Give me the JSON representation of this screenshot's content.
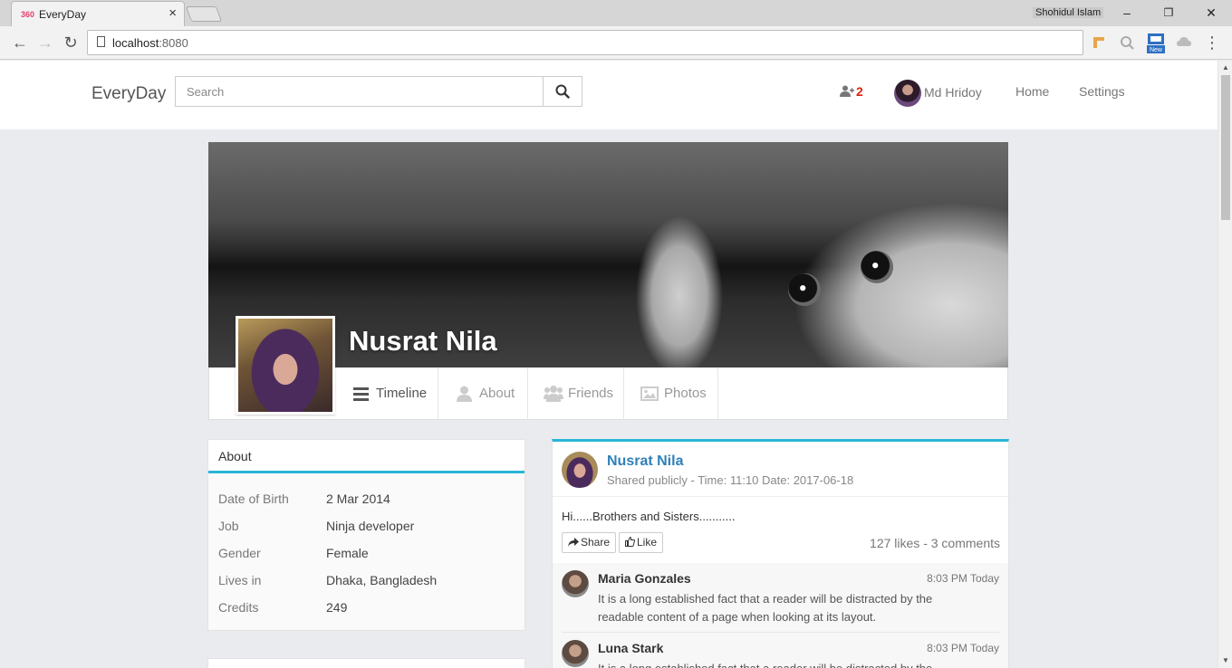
{
  "browser": {
    "tab_title": "EveryDay",
    "tab_favicon": "360",
    "tab_close": "×",
    "profile_name": "Shohidul Islam",
    "window": {
      "minimize": "–",
      "restore": "❐",
      "close": "✕"
    },
    "nav": {
      "back": "←",
      "forward": "→",
      "reload": "↻",
      "menu": "⋮"
    },
    "url_host": "localhost",
    "url_port": ":8080",
    "extension_badge": "New"
  },
  "site": {
    "brand": "EveryDay",
    "search_placeholder": "Search",
    "friend_requests_count": "2",
    "user_name": "Md Hridoy",
    "nav_links": [
      "Home",
      "Settings"
    ]
  },
  "profile": {
    "name": "Nusrat Nila",
    "tabs": [
      {
        "label": "Timeline",
        "icon": "bars-icon",
        "active": true
      },
      {
        "label": "About",
        "icon": "user-icon",
        "active": false
      },
      {
        "label": "Friends",
        "icon": "users-icon",
        "active": false
      },
      {
        "label": "Photos",
        "icon": "image-icon",
        "active": false
      }
    ]
  },
  "about": {
    "heading": "About",
    "rows": [
      {
        "key": "Date of Birth",
        "value": "2 Mar 2014"
      },
      {
        "key": "Job",
        "value": "Ninja developer"
      },
      {
        "key": "Gender",
        "value": "Female"
      },
      {
        "key": "Lives in",
        "value": "Dhaka, Bangladesh"
      },
      {
        "key": "Credits",
        "value": "249"
      }
    ]
  },
  "post": {
    "author": "Nusrat Nila",
    "meta": "Shared publicly -  Time:  11:10   Date:  2017-06-18",
    "text": "Hi......Brothers and Sisters...........",
    "share_label": "Share",
    "like_label": "Like",
    "stats": "127 likes - 3 comments",
    "comments": [
      {
        "name": "Maria Gonzales",
        "time": "8:03 PM Today",
        "text": "It is a long established fact that a reader will be distracted by the readable content of a page when looking at its layout."
      },
      {
        "name": "Luna Stark",
        "time": "8:03 PM Today",
        "text": "It is a long established fact that a reader will be distracted by the readable content of a page when looking at its layout."
      }
    ]
  },
  "colors": {
    "accent": "#29b6d8",
    "link": "#2f80b8",
    "badge": "#d9230f",
    "page_bg": "#e9ebee"
  }
}
